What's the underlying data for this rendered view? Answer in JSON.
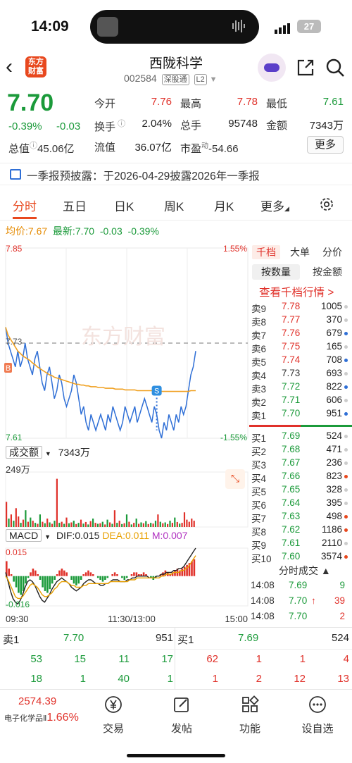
{
  "status_bar": {
    "time": "14:09",
    "battery": "27"
  },
  "header": {
    "logo_line1": "东方",
    "logo_line2": "财富",
    "stock_name": "西陇科学",
    "stock_code": "002584",
    "tag_connect": "深股通",
    "tag_level": "L2"
  },
  "quote": {
    "price": "7.70",
    "change_pct": "-0.39%",
    "change_abs": "-0.03",
    "open_label": "今开",
    "open": "7.76",
    "high_label": "最高",
    "high": "7.78",
    "low_label": "最低",
    "low": "7.61",
    "turnover_label": "换手",
    "turnover": "2.04%",
    "volume_label": "总手",
    "volume": "95748",
    "amount_label": "金额",
    "amount": "7343万",
    "mktcap_label": "总值",
    "mktcap": "45.06亿",
    "float_label": "流值",
    "float": "36.07亿",
    "pe_label": "市盈",
    "pe_sup": "动",
    "pe": "-54.66",
    "more_label": "更多"
  },
  "notice": {
    "text": "一季报预披露：于2026-04-29披露2026年一季报"
  },
  "tabs": [
    "分时",
    "五日",
    "日K",
    "周K",
    "月K",
    "更多"
  ],
  "avg_line": {
    "avg_label": "均价:",
    "avg": "7.67",
    "latest_label": "最新:",
    "latest": "7.70",
    "chg": "-0.03",
    "pct": "-0.39%"
  },
  "chart_data": [
    {
      "type": "line",
      "title": "分时",
      "y_top_label": "7.85",
      "y_bottom_label": "7.61",
      "y_ref_label": "7.73",
      "pct_top_label": "1.55%",
      "pct_bottom_label": "-1.55%",
      "ylim": [
        7.61,
        7.85
      ],
      "prev_close": 7.73,
      "x_labels": [
        "09:30",
        "11:30/13:00",
        "15:00"
      ],
      "watermark": "东方财富",
      "marker_labels": [
        "B",
        "S"
      ],
      "series": [
        {
          "name": "最新",
          "color": "#2f6fd6",
          "values": [
            7.75,
            7.73,
            7.72,
            7.71,
            7.7,
            7.72,
            7.7,
            7.71,
            7.73,
            7.71,
            7.7,
            7.69,
            7.71,
            7.72,
            7.7,
            7.68,
            7.67,
            7.69,
            7.7,
            7.68,
            7.66,
            7.67,
            7.69,
            7.68,
            7.66,
            7.65,
            7.66,
            7.67,
            7.69,
            7.68,
            7.66,
            7.64,
            7.65,
            7.63,
            7.62,
            7.64,
            7.63,
            7.62,
            7.63,
            7.64,
            7.63,
            7.62,
            7.64,
            7.63,
            7.65,
            7.64,
            7.63,
            7.62,
            7.63,
            7.65,
            7.64,
            7.63,
            7.64,
            7.65,
            7.63,
            7.64,
            7.65,
            7.66,
            7.65,
            7.64,
            7.63,
            7.65,
            7.64,
            7.62,
            7.61,
            7.63,
            7.62,
            7.64,
            7.63,
            7.62,
            7.64,
            7.63,
            7.65,
            7.64,
            7.65,
            7.67,
            7.69,
            7.7,
            7.72
          ]
        },
        {
          "name": "均价",
          "color": "#f0a020",
          "values": [
            7.75,
            7.74,
            7.735,
            7.73,
            7.725,
            7.72,
            7.717,
            7.714,
            7.712,
            7.71,
            7.708,
            7.705,
            7.703,
            7.7,
            7.698,
            7.696,
            7.694,
            7.692,
            7.69,
            7.689,
            7.687,
            7.686,
            7.685,
            7.684,
            7.683,
            7.682,
            7.681,
            7.68,
            7.679,
            7.678,
            7.678,
            7.677,
            7.677,
            7.676,
            7.676,
            7.675,
            7.675,
            7.675,
            7.674,
            7.674,
            7.674,
            7.673,
            7.673,
            7.673,
            7.673,
            7.672,
            7.672,
            7.672,
            7.672,
            7.671,
            7.671,
            7.671,
            7.671,
            7.671,
            7.67,
            7.67,
            7.67,
            7.67,
            7.67,
            7.67,
            7.67,
            7.669,
            7.669,
            7.669,
            7.669,
            7.669,
            7.669,
            7.669,
            7.669,
            7.669,
            7.669,
            7.669,
            7.669,
            7.669,
            7.669,
            7.669,
            7.67,
            7.67,
            7.67
          ]
        }
      ]
    },
    {
      "type": "bar",
      "title": "成交额",
      "total_label": "7343万",
      "max_label": "249万",
      "ylim": [
        0,
        249
      ],
      "values": [
        120,
        40,
        60,
        30,
        90,
        50,
        20,
        35,
        80,
        25,
        45,
        30,
        20,
        15,
        60,
        25,
        18,
        40,
        22,
        15,
        30,
        230,
        20,
        25,
        15,
        45,
        18,
        22,
        30,
        14,
        20,
        35,
        16,
        24,
        12,
        28,
        40,
        20,
        15,
        18,
        25,
        12,
        35,
        22,
        15,
        80,
        20,
        30,
        14,
        18,
        60,
        25,
        12,
        20,
        40,
        15,
        22,
        18,
        28,
        14,
        20,
        16,
        30,
        60,
        25,
        18,
        22,
        14,
        30,
        20,
        45,
        24,
        16,
        20,
        70,
        35,
        25,
        40,
        30
      ],
      "colors": [
        "r",
        "g",
        "r",
        "g",
        "r",
        "r",
        "g",
        "r",
        "g",
        "r",
        "g",
        "r",
        "g",
        "r",
        "g",
        "r",
        "g",
        "r",
        "g",
        "r",
        "g",
        "r",
        "g",
        "r",
        "g",
        "r",
        "g",
        "r",
        "g",
        "r",
        "g",
        "r",
        "g",
        "r",
        "g",
        "r",
        "g",
        "r",
        "g",
        "r",
        "g",
        "r",
        "g",
        "r",
        "g",
        "r",
        "g",
        "r",
        "g",
        "r",
        "g",
        "r",
        "g",
        "r",
        "g",
        "r",
        "g",
        "r",
        "g",
        "r",
        "g",
        "r",
        "g",
        "r",
        "g",
        "r",
        "g",
        "r",
        "g",
        "r",
        "g",
        "r",
        "g",
        "r",
        "r",
        "r",
        "r",
        "r",
        "r"
      ]
    },
    {
      "type": "bar",
      "title": "MACD",
      "dif_label": "DIF:0.015",
      "dea_label": "DEA:0.011",
      "m_label": "M:0.007",
      "y_top_label": "0.015",
      "y_bottom_label": "-0.016",
      "ylim": [
        -0.016,
        0.015
      ],
      "histogram": [
        0.008,
        0.004,
        0.001,
        -0.003,
        -0.006,
        -0.009,
        -0.01,
        -0.008,
        -0.004,
        -0.001,
        0.002,
        0.004,
        0.003,
        0.001,
        -0.002,
        -0.006,
        -0.008,
        -0.009,
        -0.007,
        -0.004,
        -0.002,
        0.001,
        0.003,
        0.004,
        0.003,
        0.002,
        0.0,
        -0.002,
        -0.004,
        -0.005,
        -0.004,
        -0.002,
        0.001,
        0.002,
        0.003,
        0.002,
        0.001,
        0.0,
        -0.001,
        -0.002,
        -0.003,
        -0.002,
        -0.001,
        0.0,
        0.001,
        0.002,
        0.001,
        0.0,
        -0.001,
        -0.002,
        -0.001,
        0.0,
        0.001,
        0.002,
        0.002,
        0.001,
        0.001,
        0.002,
        0.001,
        0.0,
        -0.001,
        -0.002,
        -0.001,
        0.0,
        0.001,
        0.002,
        0.003,
        0.002,
        0.001,
        0.002,
        0.003,
        0.004,
        0.003,
        0.004,
        0.005,
        0.006,
        0.007,
        0.008,
        0.009
      ],
      "dif": [
        0.002,
        -0.003,
        -0.008,
        -0.012,
        -0.014,
        -0.015,
        -0.013,
        -0.01,
        -0.006,
        -0.003,
        -0.002,
        -0.003,
        -0.005,
        -0.008,
        -0.011,
        -0.013,
        -0.014,
        -0.012,
        -0.01,
        -0.007,
        -0.005,
        -0.003,
        -0.002,
        -0.001,
        -0.002,
        -0.003,
        -0.004,
        -0.006,
        -0.007,
        -0.008,
        -0.007,
        -0.006,
        -0.004,
        -0.003,
        -0.002,
        -0.002,
        -0.003,
        -0.004,
        -0.004,
        -0.005,
        -0.005,
        -0.004,
        -0.004,
        -0.003,
        -0.002,
        -0.002,
        -0.002,
        -0.003,
        -0.003,
        -0.003,
        -0.002,
        -0.002,
        -0.001,
        -0.001,
        0.0,
        0.0,
        0.0,
        0.0,
        0.0,
        -0.001,
        -0.001,
        -0.001,
        0.0,
        0.0,
        0.001,
        0.001,
        0.002,
        0.002,
        0.002,
        0.003,
        0.003,
        0.004,
        0.004,
        0.005,
        0.007,
        0.009,
        0.011,
        0.013,
        0.015
      ],
      "dea": [
        0.0,
        -0.002,
        -0.005,
        -0.008,
        -0.011,
        -0.012,
        -0.012,
        -0.011,
        -0.009,
        -0.007,
        -0.005,
        -0.004,
        -0.005,
        -0.006,
        -0.008,
        -0.01,
        -0.011,
        -0.011,
        -0.01,
        -0.009,
        -0.007,
        -0.006,
        -0.004,
        -0.003,
        -0.003,
        -0.003,
        -0.004,
        -0.005,
        -0.005,
        -0.006,
        -0.006,
        -0.006,
        -0.005,
        -0.005,
        -0.004,
        -0.004,
        -0.004,
        -0.004,
        -0.004,
        -0.004,
        -0.004,
        -0.004,
        -0.004,
        -0.003,
        -0.003,
        -0.003,
        -0.003,
        -0.003,
        -0.003,
        -0.003,
        -0.003,
        -0.002,
        -0.002,
        -0.002,
        -0.001,
        -0.001,
        -0.001,
        -0.001,
        -0.001,
        -0.001,
        -0.001,
        -0.001,
        -0.001,
        -0.001,
        0.0,
        0.0,
        0.001,
        0.001,
        0.001,
        0.002,
        0.002,
        0.002,
        0.003,
        0.003,
        0.004,
        0.005,
        0.007,
        0.009,
        0.011
      ]
    }
  ],
  "volume_panel": {
    "title": "成交额",
    "total": "7343万",
    "max": "249万"
  },
  "macd_panel": {
    "title": "MACD",
    "dif": "DIF:0.015",
    "dea": "DEA:0.011",
    "m": "M:0.007",
    "top": "0.015",
    "bottom": "-0.016"
  },
  "book": {
    "tab1": "千档",
    "tab2": "大单",
    "tab3": "分价",
    "sub1": "按数量",
    "sub2": "按金额",
    "link": "查看千档行情 >",
    "asks": [
      {
        "label": "卖9",
        "price": "7.78",
        "vol": "1005",
        "dot": "#cccccc"
      },
      {
        "label": "卖8",
        "price": "7.77",
        "vol": "370",
        "dot": "#cccccc"
      },
      {
        "label": "卖7",
        "price": "7.76",
        "vol": "679",
        "dot": "#2f6fd6"
      },
      {
        "label": "卖6",
        "price": "7.75",
        "vol": "165",
        "dot": "#cccccc"
      },
      {
        "label": "卖5",
        "price": "7.74",
        "vol": "708",
        "dot": "#2f6fd6"
      },
      {
        "label": "卖4",
        "price": "7.73",
        "vol": "693",
        "dot": "#cccccc"
      },
      {
        "label": "卖3",
        "price": "7.72",
        "vol": "822",
        "dot": "#2f6fd6"
      },
      {
        "label": "卖2",
        "price": "7.71",
        "vol": "606",
        "dot": "#cccccc"
      },
      {
        "label": "卖1",
        "price": "7.70",
        "vol": "951",
        "dot": "#2f6fd6"
      }
    ],
    "bids": [
      {
        "label": "买1",
        "price": "7.69",
        "vol": "524",
        "dot": "#cccccc"
      },
      {
        "label": "买2",
        "price": "7.68",
        "vol": "471",
        "dot": "#cccccc"
      },
      {
        "label": "买3",
        "price": "7.67",
        "vol": "236",
        "dot": "#cccccc"
      },
      {
        "label": "买4",
        "price": "7.66",
        "vol": "823",
        "dot": "#e8481e"
      },
      {
        "label": "买5",
        "price": "7.65",
        "vol": "328",
        "dot": "#cccccc"
      },
      {
        "label": "买6",
        "price": "7.64",
        "vol": "395",
        "dot": "#cccccc"
      },
      {
        "label": "买7",
        "price": "7.63",
        "vol": "498",
        "dot": "#e8481e"
      },
      {
        "label": "买8",
        "price": "7.62",
        "vol": "1186",
        "dot": "#e8481e"
      },
      {
        "label": "买9",
        "price": "7.61",
        "vol": "2110",
        "dot": "#cccccc"
      },
      {
        "label": "买10",
        "price": "7.60",
        "vol": "3574",
        "dot": "#e8481e"
      }
    ],
    "ticks_title": "分时成交 ▲",
    "ticks": [
      {
        "time": "14:08",
        "price": "7.69",
        "vol": "9",
        "dir": "",
        "vcolor": "green"
      },
      {
        "time": "14:08",
        "price": "7.70",
        "vol": "39",
        "dir": "↑",
        "vcolor": "red"
      },
      {
        "time": "14:08",
        "price": "7.70",
        "vol": "2",
        "dir": "",
        "vcolor": "red"
      }
    ]
  },
  "depth": {
    "ask_label": "卖1",
    "ask_price": "7.70",
    "ask_vol": "951",
    "bid_label": "买1",
    "bid_price": "7.69",
    "bid_vol": "524",
    "ask_row1": [
      "53",
      "15",
      "11",
      "17"
    ],
    "ask_row2": [
      "18",
      "1",
      "40",
      "1"
    ],
    "bid_row1": [
      "62",
      "1",
      "1",
      "4"
    ],
    "bid_row2": [
      "1",
      "2",
      "12",
      "13"
    ]
  },
  "tabbar": {
    "index_value": "2574.39",
    "index_name": "电子化学品Ⅱ",
    "index_pct": "1.66%",
    "items": [
      "交易",
      "发帖",
      "功能",
      "设自选"
    ]
  }
}
